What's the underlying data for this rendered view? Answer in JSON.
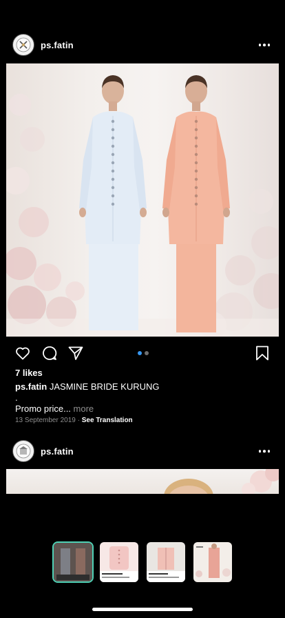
{
  "posts": [
    {
      "username": "ps.fatin",
      "likes": "7 likes",
      "caption_user": "ps.fatin",
      "caption_text": "JASMINE BRIDE KURUNG",
      "caption_dot": ".",
      "caption_line2": "Promo price...",
      "more_label": "more",
      "date": "13 September 2019",
      "separator": "·",
      "see_translation": "See Translation",
      "carousel": {
        "count": 2,
        "active": 0
      }
    },
    {
      "username": "ps.fatin"
    }
  ],
  "thumbnails": {
    "count": 4,
    "active": 0
  },
  "colors": {
    "background": "#000000",
    "text": "#ffffff",
    "muted": "#8e8e8e",
    "carousel_active": "#3897f0",
    "carousel_inactive": "#6e6e6e",
    "thumb_active_border": "#4fd1b5",
    "dress_left": "#e3ecf6",
    "dress_right": "#f4b79f"
  },
  "icons": [
    "heart-icon",
    "comment-icon",
    "share-icon",
    "bookmark-icon",
    "more-icon"
  ]
}
